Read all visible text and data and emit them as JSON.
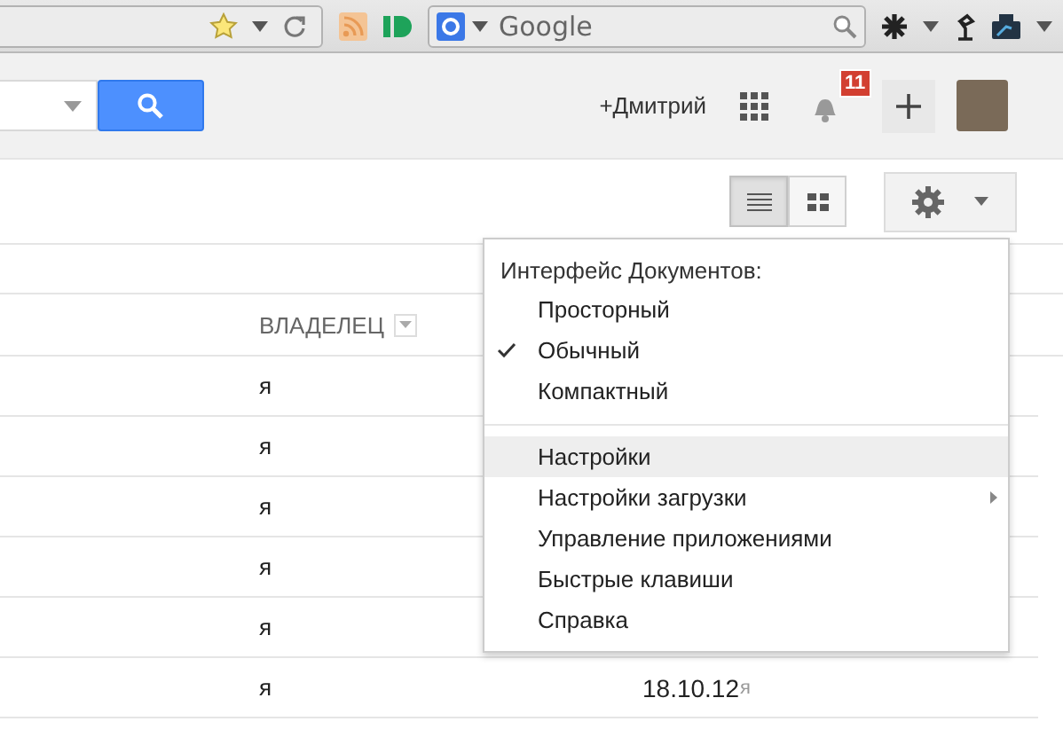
{
  "browser_toolbar": {
    "search_placeholder": "Google"
  },
  "header": {
    "user_name": "+Дмитрий",
    "notification_count": "11"
  },
  "table": {
    "columns": [
      {
        "label": "ВЛАДЕЛЕЦ"
      }
    ],
    "rows": [
      {
        "owner": "я"
      },
      {
        "owner": "я"
      },
      {
        "owner": "я"
      },
      {
        "owner": "я"
      },
      {
        "owner": "я"
      },
      {
        "owner": "я",
        "modified": "18.10.12",
        "modified_by": "я"
      }
    ]
  },
  "view_toggle": [
    {
      "kind": "list",
      "selected": true
    },
    {
      "kind": "grid",
      "selected": false
    }
  ],
  "settings_menu": {
    "heading": "Интерфейс Документов:",
    "density_options": [
      {
        "label": "Просторный",
        "selected": false
      },
      {
        "label": "Обычный",
        "selected": true
      },
      {
        "label": "Компактный",
        "selected": false
      }
    ],
    "items": [
      {
        "label": "Настройки",
        "highlighted": true,
        "submenu": false
      },
      {
        "label": "Настройки загрузки",
        "highlighted": false,
        "submenu": true
      },
      {
        "label": "Управление приложениями",
        "highlighted": false,
        "submenu": false
      },
      {
        "label": "Быстрые клавиши",
        "highlighted": false,
        "submenu": false
      },
      {
        "label": "Справка",
        "highlighted": false,
        "submenu": false
      }
    ]
  }
}
